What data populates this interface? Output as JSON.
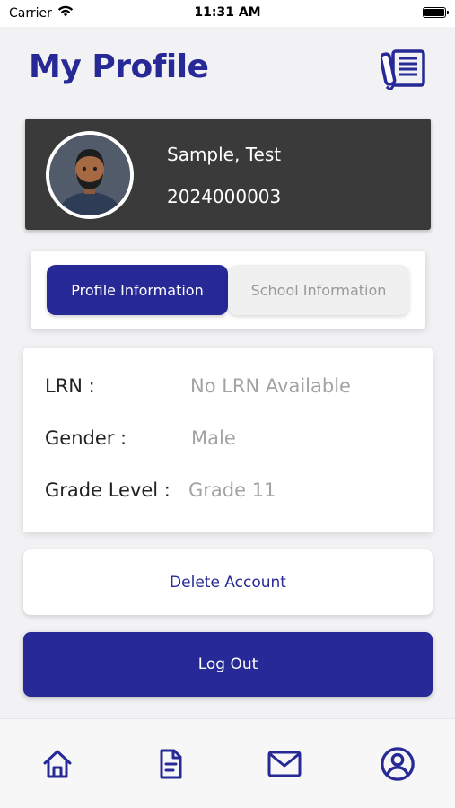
{
  "status_bar": {
    "carrier": "Carrier",
    "time": "11:31 AM",
    "wifi_icon": "wifi-icon",
    "battery_icon": "battery-icon"
  },
  "header": {
    "title": "My Profile",
    "action_icon": "documents-icon"
  },
  "profile": {
    "name": "Sample, Test",
    "id_number": "2024000003",
    "avatar_icon": "avatar-image"
  },
  "tabs": [
    {
      "label": "Profile Information",
      "active": true
    },
    {
      "label": "School Information",
      "active": false
    }
  ],
  "info": {
    "rows": [
      {
        "label": "LRN :",
        "value": "No LRN Available"
      },
      {
        "label": "Gender :",
        "value": "Male"
      },
      {
        "label": "Grade Level :",
        "value": "Grade 11"
      }
    ]
  },
  "actions": {
    "delete_label": "Delete Account",
    "logout_label": "Log Out"
  },
  "bottom_nav": {
    "items": [
      {
        "icon": "home-icon"
      },
      {
        "icon": "document-icon"
      },
      {
        "icon": "mail-icon"
      },
      {
        "icon": "profile-icon"
      }
    ]
  },
  "colors": {
    "primary": "#262996",
    "card_dark": "#3a3a3a",
    "muted_text": "#a3a3a3",
    "background": "#f2f2f4"
  }
}
